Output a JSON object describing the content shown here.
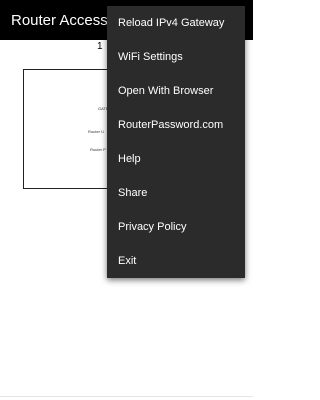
{
  "app_bar": {
    "title": "Router Access"
  },
  "ip_readout": {
    "text": "1"
  },
  "web_frame": {
    "lines": [
      "GATEW",
      "Router U",
      "Router P"
    ]
  },
  "menu": {
    "items": [
      {
        "label": "Reload IPv4 Gateway"
      },
      {
        "label": "WiFi Settings"
      },
      {
        "label": "Open With Browser"
      },
      {
        "label": "RouterPassword.com"
      },
      {
        "label": "Help"
      },
      {
        "label": "Share"
      },
      {
        "label": "Privacy Policy"
      },
      {
        "label": "Exit"
      }
    ]
  }
}
